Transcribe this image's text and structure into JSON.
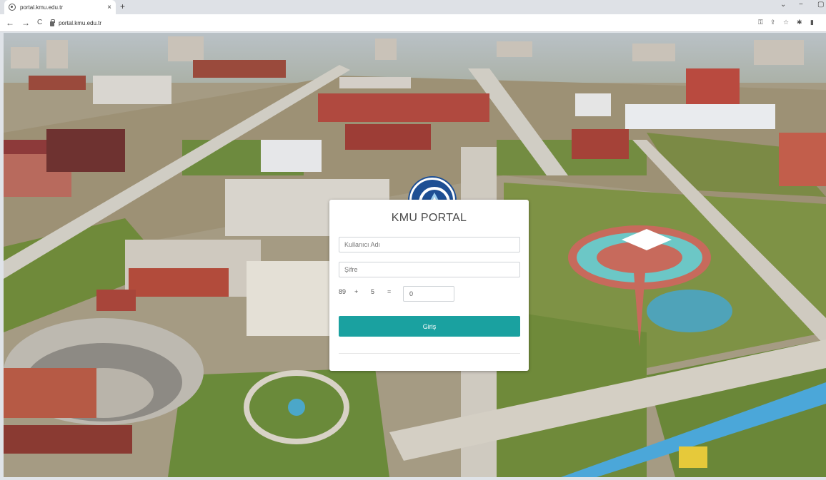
{
  "browser": {
    "tab_title": "portal.kmu.edu.tr",
    "tab_close": "×",
    "new_tab": "+",
    "url": "portal.kmu.edu.tr",
    "back": "←",
    "forward": "→",
    "reload": "C",
    "window_menu": "⌄",
    "window_minimize": "−",
    "window_restore": "▢"
  },
  "login": {
    "title": "KMU PORTAL",
    "username_placeholder": "Kullanıcı Adı",
    "password_placeholder": "Şifre",
    "captcha": {
      "a": "89",
      "op": "+",
      "b": "5",
      "eq": "=",
      "answer": "0"
    },
    "submit_label": "Giriş"
  },
  "colors": {
    "accent": "#1aa1a0",
    "emblem": "#1e4f94"
  }
}
